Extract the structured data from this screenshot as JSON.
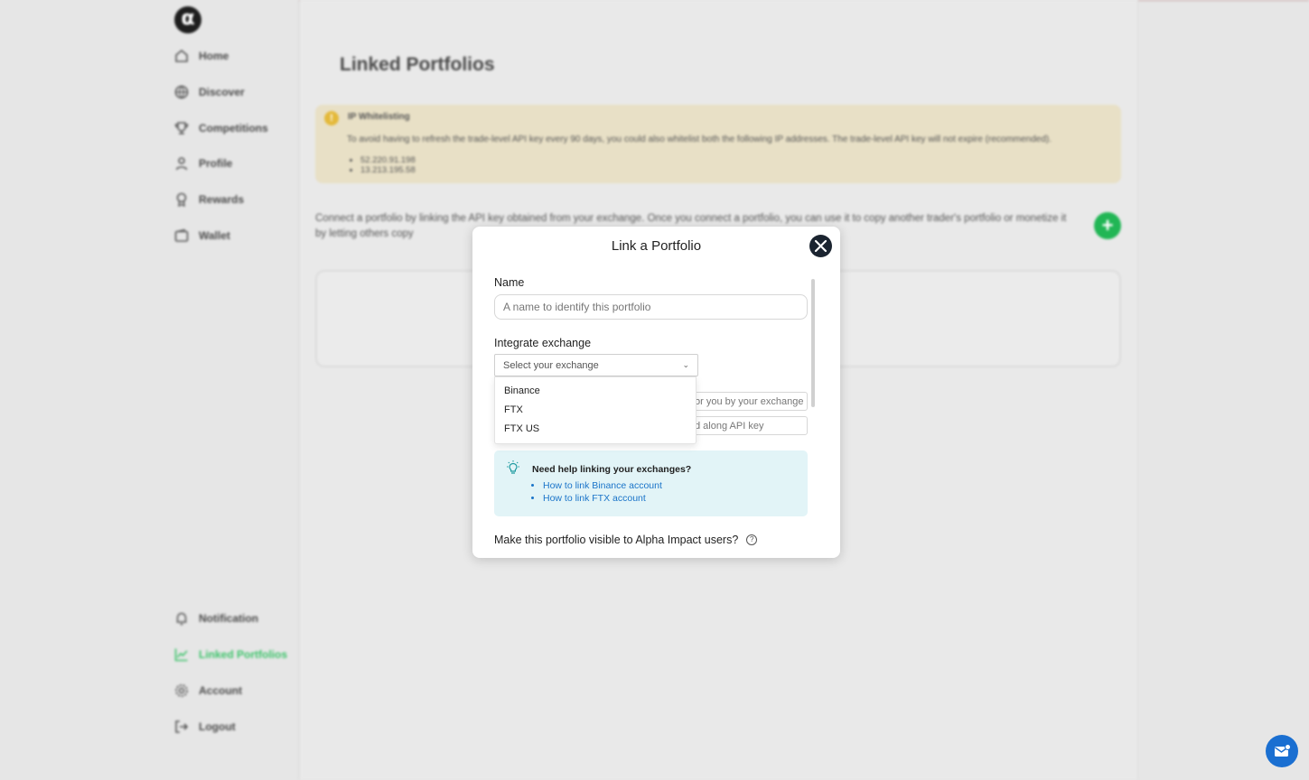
{
  "sidebar": {
    "logo": "α",
    "top_items": [
      {
        "label": "Home",
        "icon": "home-icon"
      },
      {
        "label": "Discover",
        "icon": "globe-icon"
      },
      {
        "label": "Competitions",
        "icon": "trophy-icon"
      },
      {
        "label": "Profile",
        "icon": "user-icon"
      },
      {
        "label": "Rewards",
        "icon": "medal-icon"
      },
      {
        "label": "Wallet",
        "icon": "wallet-icon"
      }
    ],
    "bottom_items": [
      {
        "label": "Notification",
        "icon": "bell-icon"
      },
      {
        "label": "Linked Portfolios",
        "icon": "chart-icon",
        "active": true
      },
      {
        "label": "Account",
        "icon": "gear-icon"
      },
      {
        "label": "Logout",
        "icon": "logout-icon"
      }
    ]
  },
  "main": {
    "title": "Linked Portfolios",
    "warning": {
      "title": "IP Whitelisting",
      "text": "To avoid having to refresh the trade-level API key every 90 days, you could also whitelist both the following IP addresses. The trade-level API key will not expire (recommended).",
      "ips": [
        "52.220.91.198",
        "13.213.195.58"
      ]
    },
    "description": "Connect a portfolio by linking the API key obtained from your exchange. Once you connect a portfolio, you can use it to copy another trader's portfolio or monetize it by letting others copy"
  },
  "modal": {
    "title": "Link a Portfolio",
    "name_label": "Name",
    "name_placeholder": "A name to identify this portfolio",
    "exchange_label": "Integrate exchange",
    "exchange_placeholder": "Select your exchange",
    "exchange_options": [
      "Binance",
      "FTX",
      "FTX US"
    ],
    "api_key_partial": "or you by your exchange",
    "secret_partial": "d along API key",
    "help": {
      "title": "Need help linking your exchanges?",
      "links": [
        "How to link Binance account",
        "How to link FTX account"
      ]
    },
    "visible_question": "Make this portfolio visible to Alpha Impact users?",
    "question_icon": "?"
  },
  "colors": {
    "accent_green": "#21b655",
    "active_nav": "#3cc36a",
    "link_blue": "#1a74c9",
    "chat_blue": "#1a6fd1"
  }
}
